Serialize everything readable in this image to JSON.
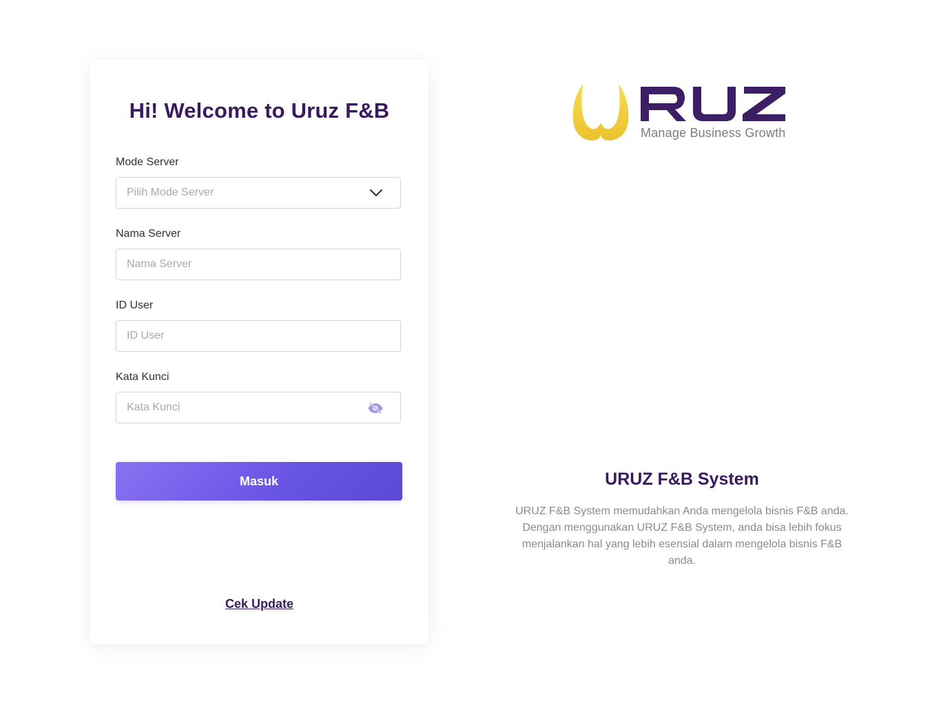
{
  "login": {
    "title": "Hi! Welcome to Uruz F&B",
    "mode_server": {
      "label": "Mode Server",
      "placeholder": "Pilih Mode Server"
    },
    "nama_server": {
      "label": "Nama Server",
      "placeholder": "Nama Server"
    },
    "id_user": {
      "label": "ID User",
      "placeholder": "ID User"
    },
    "kata_kunci": {
      "label": "Kata Kunci",
      "placeholder": "Kata Kunci"
    },
    "submit_label": "Masuk",
    "update_link": "Cek Update"
  },
  "brand": {
    "logo_text": "RUZ",
    "tagline": "Manage Business Growth",
    "system_title": "URUZ F&B System",
    "system_description": "URUZ F&B System memudahkan Anda mengelola bisnis F&B anda. Dengan menggunakan URUZ F&B System, anda bisa lebih fokus menjalankan hal yang lebih esensial dalam mengelola bisnis F&B anda."
  },
  "colors": {
    "primary_dark": "#3a1a5e",
    "button_gradient_start": "#8a72f2",
    "button_gradient_end": "#5a48d6",
    "logo_gold": "#f2cf3c",
    "placeholder": "#a8a8b0"
  },
  "icons": {
    "dropdown": "chevron-down-icon",
    "password_toggle": "eye-hidden-icon"
  }
}
